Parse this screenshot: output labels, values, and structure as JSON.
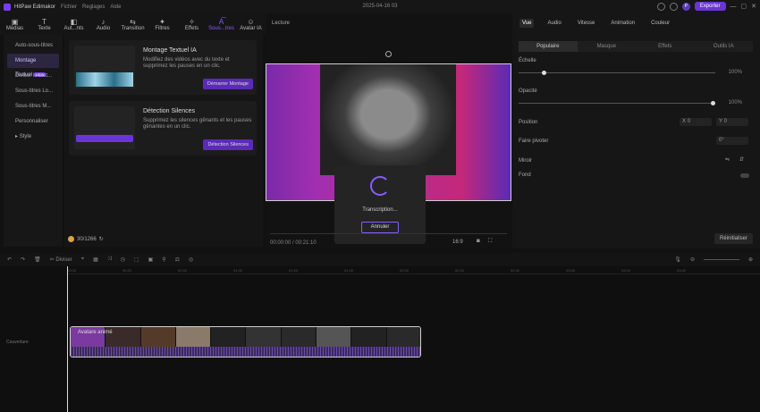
{
  "titlebar": {
    "app": "HitPaw Edimakor",
    "menus": [
      "Fichier",
      "Reglages",
      "Aide"
    ],
    "title": "2025-04-16 03",
    "avatar": "P",
    "export": "Exporter"
  },
  "toolbar": [
    {
      "label": "Médias",
      "icon": "▣"
    },
    {
      "label": "Texte",
      "icon": "T"
    },
    {
      "label": "Aut...nts",
      "icon": "◧"
    },
    {
      "label": "Audio",
      "icon": "♪"
    },
    {
      "label": "Transition",
      "icon": "⇆"
    },
    {
      "label": "Filtres",
      "icon": "✦"
    },
    {
      "label": "Effets",
      "icon": "✧"
    },
    {
      "label": "Sous...tres",
      "icon": "A͡"
    },
    {
      "label": "Avatar IA",
      "icon": "☺"
    }
  ],
  "subnav": [
    {
      "label": "Auto-sous-titres"
    },
    {
      "label": "Montage Textuel",
      "tag": "NEW"
    },
    {
      "label": "Diviser le text..."
    },
    {
      "label": "Sous-titres Lo..."
    },
    {
      "label": "Sous-titres M..."
    },
    {
      "label": "Personnaliser"
    },
    {
      "label": "Style"
    }
  ],
  "cards": [
    {
      "title": "Montage Textuel IA",
      "desc": "Modifiez des vidéos avec du texte et supprimez les pauses en un clic.",
      "button": "Démarrer Montage"
    },
    {
      "title": "Détection Silences",
      "desc": "Supprimez les silences gênants et les pauses gênantes en un clic.",
      "button": "Détection Silences"
    }
  ],
  "credits": "30/1266",
  "preview": {
    "label": "Lecture",
    "time": "00:00:00 / 00:21:10",
    "ratio": "16:9"
  },
  "modal": {
    "text": "Transcription...",
    "cancel": "Annuler"
  },
  "right": {
    "tabs": [
      "Vue",
      "Audio",
      "Vitesse",
      "Animation",
      "Couleur"
    ],
    "subtabs": [
      "Populaire",
      "Masque",
      "Effets",
      "Outils IA"
    ],
    "scale_label": "Échelle",
    "scale_val": "100%",
    "scale_level": 0.12,
    "opacity_label": "Opacité",
    "opacity_val": "100%",
    "opacity_level": 1.0,
    "position_label": "Position",
    "pos_x": "0",
    "pos_y": "0",
    "pos_x_lbl": "X",
    "pos_y_lbl": "Y",
    "rotate_label": "Faire pivoter",
    "rotate_val": "0°",
    "mirror_label": "Miroir",
    "bg_label": "Fond",
    "reset": "Réinitialiser"
  },
  "timeline": {
    "tools": [
      "↶",
      "↷",
      "🗑",
      "✂ Diviser",
      "⌖",
      "▦",
      "⤨",
      "◷",
      "⬚",
      "▣",
      "⚲",
      "⚖",
      "◎"
    ],
    "ruler": [
      "00:00",
      "00:20",
      "00:40",
      "01:00",
      "01:20",
      "01:40",
      "02:00",
      "02:20",
      "02:40",
      "03:00",
      "03:20",
      "03:40"
    ],
    "clip": "Avatare animé",
    "track_label": "Couverture"
  }
}
